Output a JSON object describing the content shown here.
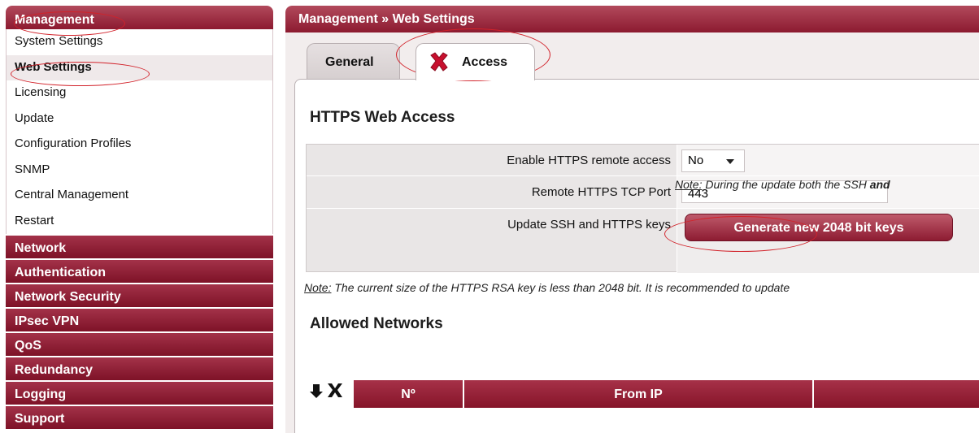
{
  "sidebar": {
    "management": {
      "title": "Management",
      "items": [
        {
          "label": "System Settings"
        },
        {
          "label": "Web Settings"
        },
        {
          "label": "Licensing"
        },
        {
          "label": "Update"
        },
        {
          "label": "Configuration Profiles"
        },
        {
          "label": "SNMP"
        },
        {
          "label": "Central Management"
        },
        {
          "label": "Restart"
        }
      ],
      "active": "Web Settings"
    },
    "sections": [
      {
        "label": "Network"
      },
      {
        "label": "Authentication"
      },
      {
        "label": "Network Security"
      },
      {
        "label": "IPsec VPN"
      },
      {
        "label": "QoS"
      },
      {
        "label": "Redundancy"
      },
      {
        "label": "Logging"
      },
      {
        "label": "Support"
      }
    ]
  },
  "main": {
    "breadcrumb": "Management » Web Settings",
    "tabs": [
      {
        "label": "General",
        "icon": ""
      },
      {
        "label": "Access",
        "icon": "red-x-icon"
      }
    ],
    "active_tab": "Access",
    "https_section": {
      "title": "HTTPS Web Access",
      "rows": {
        "enable_remote": {
          "label": "Enable HTTPS remote access",
          "value": "No"
        },
        "tcp_port": {
          "label": "Remote HTTPS TCP Port",
          "value": "443"
        },
        "update_keys": {
          "label": "Update SSH and HTTPS keys",
          "button": "Generate new 2048 bit keys"
        }
      },
      "inline_note": {
        "prefix": "Note:",
        "text": " During the update both the SSH ",
        "bold": "and"
      },
      "note": {
        "prefix": "Note:",
        "text": " The current size of the HTTPS RSA key is less than 2048 bit. It is recommended to update"
      }
    },
    "allowed_networks": {
      "title": "Allowed Networks",
      "columns": [
        "Nº",
        "From IP",
        ""
      ]
    }
  },
  "colors": {
    "accent": "#8c1a30",
    "annotation": "#d2222a"
  }
}
